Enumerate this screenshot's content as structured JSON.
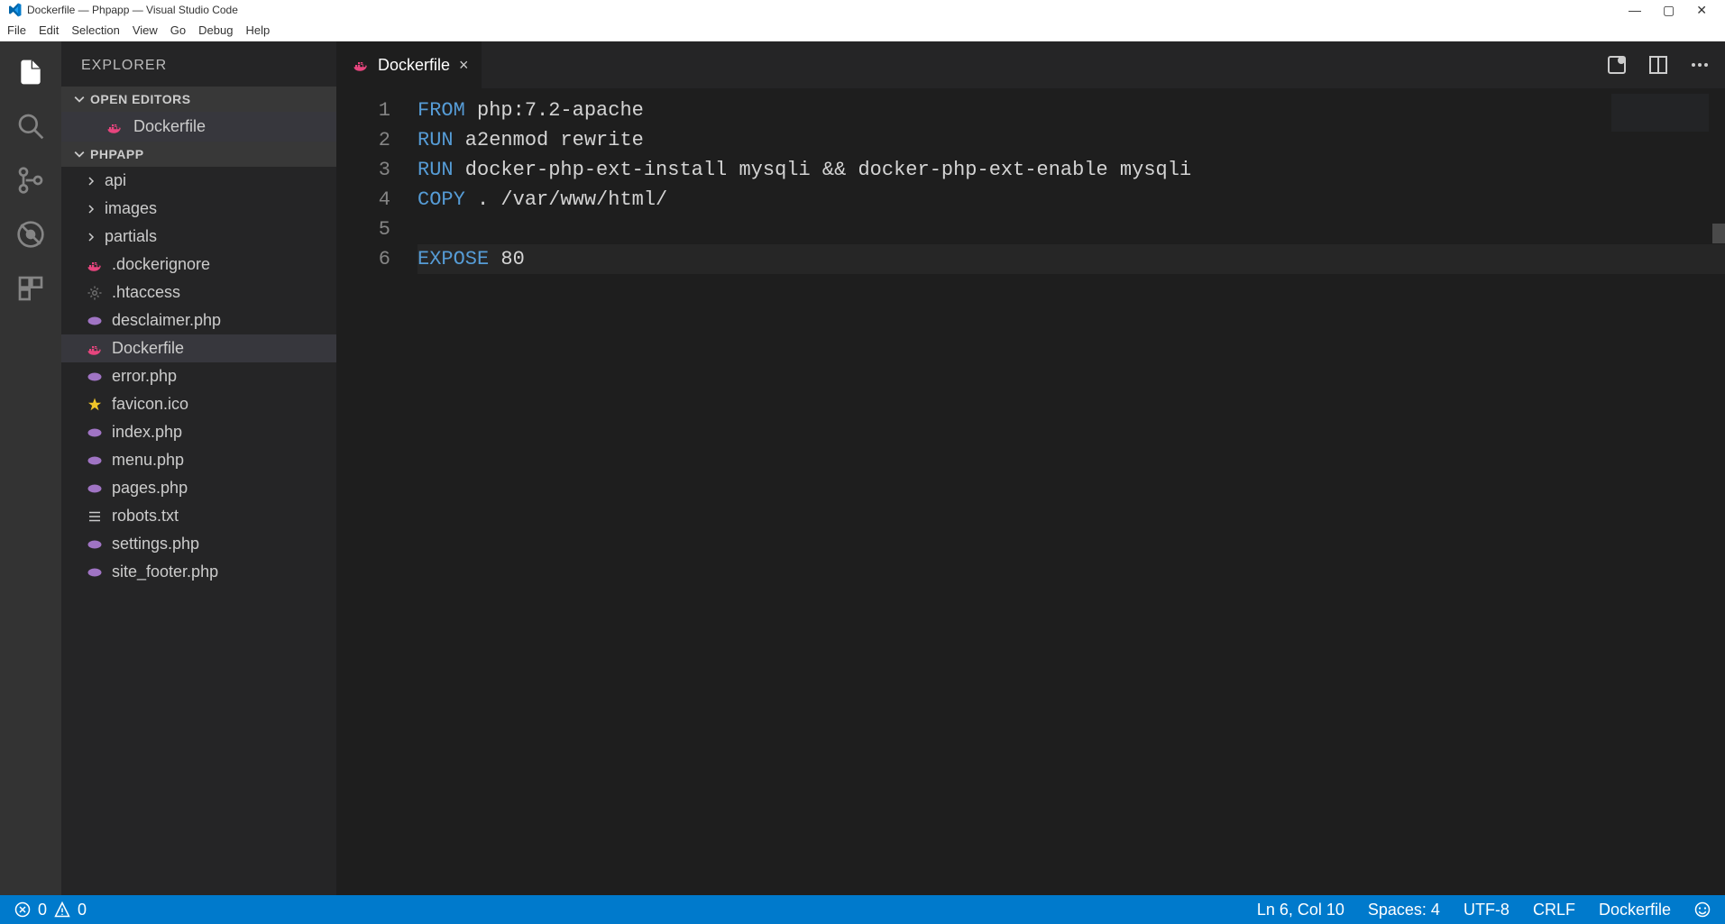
{
  "window": {
    "title": "Dockerfile — Phpapp — Visual Studio Code"
  },
  "menu": {
    "file": "File",
    "edit": "Edit",
    "selection": "Selection",
    "view": "View",
    "go": "Go",
    "debug": "Debug",
    "help": "Help"
  },
  "sidebar": {
    "title": "EXPLORER",
    "open_editors_label": "OPEN EDITORS",
    "open_editor_item": "Dockerfile",
    "project_label": "PHPAPP",
    "items": [
      {
        "type": "folder",
        "label": "api"
      },
      {
        "type": "folder",
        "label": "images"
      },
      {
        "type": "folder",
        "label": "partials"
      },
      {
        "type": "file",
        "icon": "docker",
        "label": ".dockerignore"
      },
      {
        "type": "file",
        "icon": "gear",
        "label": ".htaccess"
      },
      {
        "type": "file",
        "icon": "php",
        "label": "desclaimer.php"
      },
      {
        "type": "file",
        "icon": "docker",
        "label": "Dockerfile",
        "selected": true
      },
      {
        "type": "file",
        "icon": "php",
        "label": "error.php"
      },
      {
        "type": "file",
        "icon": "star",
        "label": "favicon.ico"
      },
      {
        "type": "file",
        "icon": "php",
        "label": "index.php"
      },
      {
        "type": "file",
        "icon": "php",
        "label": "menu.php"
      },
      {
        "type": "file",
        "icon": "php",
        "label": "pages.php"
      },
      {
        "type": "file",
        "icon": "lines",
        "label": "robots.txt"
      },
      {
        "type": "file",
        "icon": "php",
        "label": "settings.php"
      },
      {
        "type": "file",
        "icon": "php",
        "label": "site_footer.php"
      }
    ]
  },
  "tab": {
    "label": "Dockerfile"
  },
  "editor": {
    "lines": [
      {
        "kw": "FROM",
        "rest": " php:7.2-apache"
      },
      {
        "kw": "RUN",
        "rest": " a2enmod rewrite"
      },
      {
        "kw": "RUN",
        "rest": " docker-php-ext-install mysqli && docker-php-ext-enable mysqli"
      },
      {
        "kw": "COPY",
        "rest": " . /var/www/html/"
      },
      {
        "kw": "",
        "rest": ""
      },
      {
        "kw": "EXPOSE",
        "rest": " 80",
        "current": true
      }
    ]
  },
  "status": {
    "errors": "0",
    "warnings": "0",
    "position": "Ln 6, Col 10",
    "spaces": "Spaces: 4",
    "encoding": "UTF-8",
    "eol": "CRLF",
    "language": "Dockerfile"
  }
}
